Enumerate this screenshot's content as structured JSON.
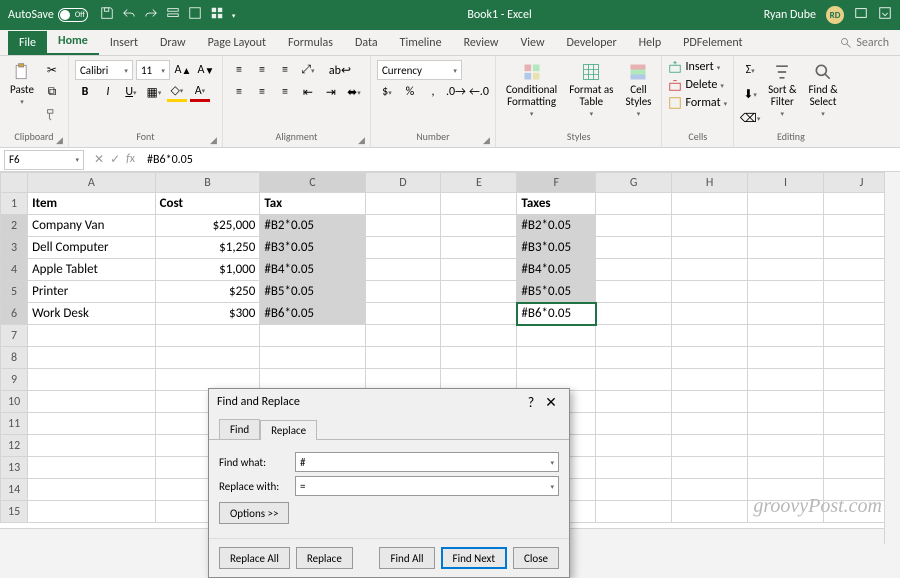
{
  "titlebar": {
    "autosave_label": "AutoSave",
    "autosave_state": "Off",
    "title": "Book1 - Excel",
    "user_name": "Ryan Dube",
    "user_initials": "RD"
  },
  "tabs": {
    "file": "File",
    "items": [
      "Home",
      "Insert",
      "Draw",
      "Page Layout",
      "Formulas",
      "Data",
      "Timeline",
      "Review",
      "View",
      "Developer",
      "Help",
      "PDFelement"
    ],
    "active": "Home",
    "search": "Search"
  },
  "ribbon": {
    "clipboard": {
      "label": "Clipboard",
      "paste": "Paste"
    },
    "font": {
      "label": "Font",
      "name": "Calibri",
      "size": "11"
    },
    "alignment": {
      "label": "Alignment"
    },
    "number": {
      "label": "Number",
      "format": "Currency"
    },
    "styles": {
      "label": "Styles",
      "cond": "Conditional\nFormatting",
      "fat": "Format as\nTable",
      "cs": "Cell\nStyles"
    },
    "cells": {
      "label": "Cells",
      "insert": "Insert",
      "delete": "Delete",
      "format": "Format"
    },
    "editing": {
      "label": "Editing",
      "sort": "Sort &\nFilter",
      "find": "Find &\nSelect"
    }
  },
  "namebox": "F6",
  "formula": "#B6*0.05",
  "columns": [
    "A",
    "B",
    "C",
    "D",
    "E",
    "F",
    "G",
    "H",
    "I",
    "J"
  ],
  "sheet": {
    "headers": {
      "A": "Item",
      "B": "Cost",
      "C": "Tax",
      "F": "Taxes"
    },
    "rows": [
      {
        "A": "Company Van",
        "B": "$25,000",
        "C": "#B2*0.05",
        "F": "#B2*0.05"
      },
      {
        "A": "Dell Computer",
        "B": "$1,250",
        "C": "#B3*0.05",
        "F": "#B3*0.05"
      },
      {
        "A": "Apple Tablet",
        "B": "$1,000",
        "C": "#B4*0.05",
        "F": "#B4*0.05"
      },
      {
        "A": "Printer",
        "B": "$250",
        "C": "#B5*0.05",
        "F": "#B5*0.05"
      },
      {
        "A": "Work Desk",
        "B": "$300",
        "C": "#B6*0.05",
        "F": "#B6*0.05"
      }
    ]
  },
  "dialog": {
    "title": "Find and Replace",
    "tab_find": "Find",
    "tab_replace": "Replace",
    "find_what_label": "Find what:",
    "find_what": "#",
    "replace_with_label": "Replace with:",
    "replace_with": "=",
    "options": "Options >>",
    "replace_all": "Replace All",
    "replace": "Replace",
    "find_all": "Find All",
    "find_next": "Find Next",
    "close": "Close"
  },
  "watermark": "groovyPost.com"
}
